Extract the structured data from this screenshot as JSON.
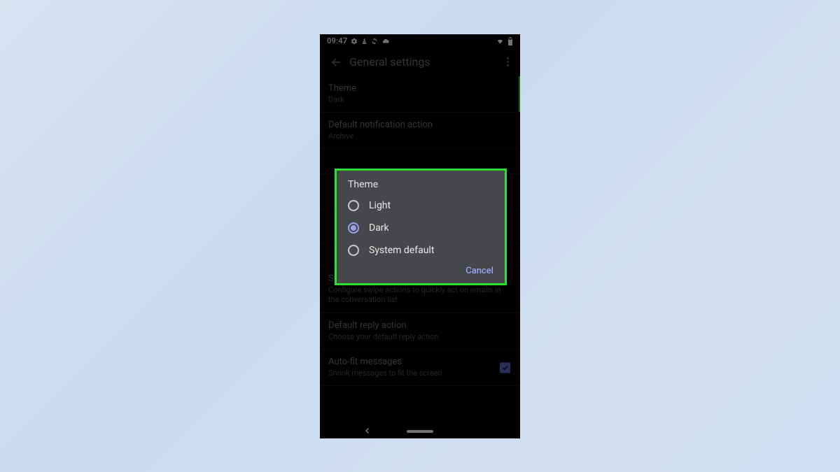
{
  "statusbar": {
    "time": "09:47"
  },
  "appbar": {
    "title": "General settings"
  },
  "settings": {
    "theme": {
      "title": "Theme",
      "sub": "Dark"
    },
    "notif": {
      "title": "Default notification action",
      "sub": "Archive"
    },
    "swipe": {
      "title": "Swipe actions",
      "sub": "Configure swipe actions to quickly act on emails in the conversation list"
    },
    "reply": {
      "title": "Default reply action",
      "sub": "Choose your default reply action"
    },
    "autofit": {
      "title": "Auto-fit messages",
      "sub": "Shrink messages to fit the screen"
    }
  },
  "dialog": {
    "title": "Theme",
    "options": {
      "light": "Light",
      "dark": "Dark",
      "system": "System default"
    },
    "selected": "dark",
    "cancel": "Cancel"
  }
}
